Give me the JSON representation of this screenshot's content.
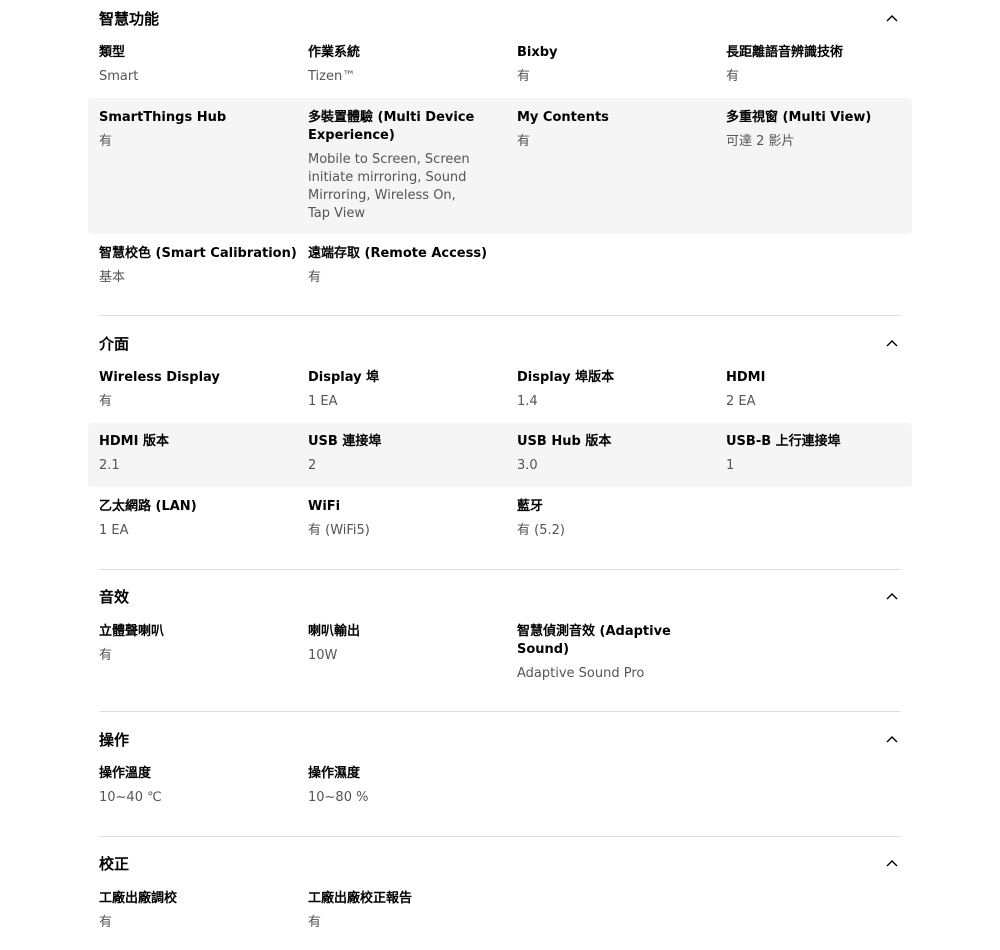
{
  "sections": {
    "smart": {
      "title": "智慧功能",
      "rows": [
        [
          {
            "label": "類型",
            "value": "Smart"
          },
          {
            "label": "作業系統",
            "value": "Tizen™"
          },
          {
            "label": "Bixby",
            "value": "有"
          },
          {
            "label": "長距離語音辨識技術",
            "value": "有"
          }
        ],
        [
          {
            "label": "SmartThings Hub",
            "value": "有"
          },
          {
            "label": "多裝置體驗 (Multi Device Experience)",
            "value": "Mobile to Screen, Screen initiate mirroring, Sound Mirroring, Wireless On, Tap View"
          },
          {
            "label": "My Contents",
            "value": "有"
          },
          {
            "label": "多重視窗 (Multi View)",
            "value": "可達 2 影片"
          }
        ],
        [
          {
            "label": "智慧校色 (Smart Calibration)",
            "value": "基本"
          },
          {
            "label": "遠端存取 (Remote Access)",
            "value": "有"
          }
        ]
      ]
    },
    "interface": {
      "title": "介面",
      "rows": [
        [
          {
            "label": "Wireless Display",
            "value": "有"
          },
          {
            "label": "Display 埠",
            "value": "1 EA"
          },
          {
            "label": "Display 埠版本",
            "value": "1.4"
          },
          {
            "label": "HDMI",
            "value": "2 EA"
          }
        ],
        [
          {
            "label": "HDMI 版本",
            "value": "2.1"
          },
          {
            "label": "USB 連接埠",
            "value": "2"
          },
          {
            "label": "USB Hub 版本",
            "value": "3.0"
          },
          {
            "label": "USB-B 上行連接埠",
            "value": "1"
          }
        ],
        [
          {
            "label": "乙太網路 (LAN)",
            "value": "1 EA"
          },
          {
            "label": "WiFi",
            "value": "有 (WiFi5)"
          },
          {
            "label": "藍牙",
            "value": "有 (5.2)"
          }
        ]
      ]
    },
    "audio": {
      "title": "音效",
      "rows": [
        [
          {
            "label": "立體聲喇叭",
            "value": "有"
          },
          {
            "label": "喇叭輸出",
            "value": "10W"
          },
          {
            "label": "智慧偵測音效 (Adaptive Sound)",
            "value": "Adaptive Sound Pro"
          }
        ]
      ]
    },
    "operation": {
      "title": "操作",
      "rows": [
        [
          {
            "label": "操作溫度",
            "value": "10~40 ℃"
          },
          {
            "label": "操作濕度",
            "value": "10~80 %"
          }
        ]
      ]
    },
    "calibration": {
      "title": "校正",
      "rows": [
        [
          {
            "label": "工廠出廠調校",
            "value": "有"
          },
          {
            "label": "工廠出廠校正報告",
            "value": "有"
          }
        ]
      ]
    }
  },
  "icons": {
    "collapse": "chevron-up-icon"
  }
}
